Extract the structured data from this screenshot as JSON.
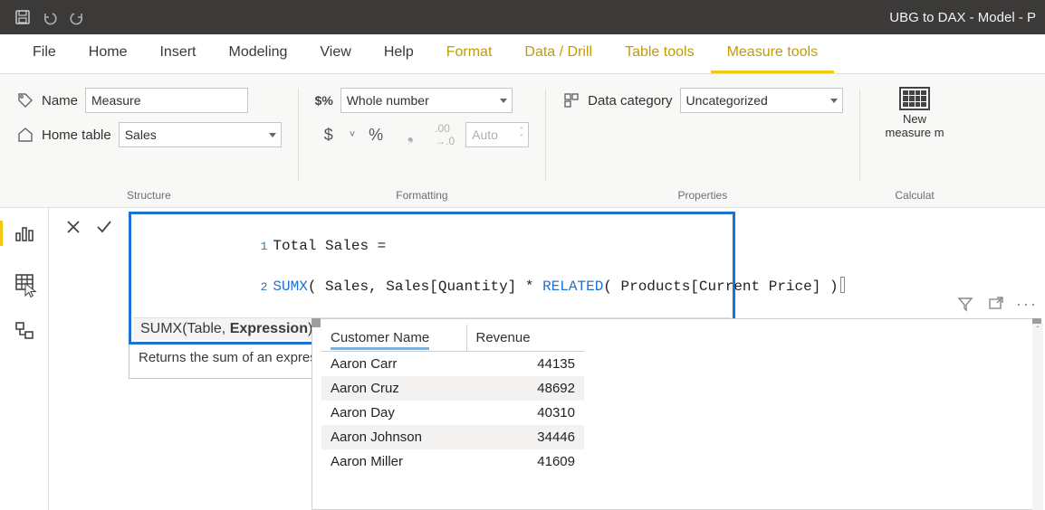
{
  "titlebar": {
    "title": "UBG to DAX - Model - P"
  },
  "tabs": {
    "items": [
      {
        "label": "File"
      },
      {
        "label": "Home"
      },
      {
        "label": "Insert"
      },
      {
        "label": "Modeling"
      },
      {
        "label": "View"
      },
      {
        "label": "Help"
      },
      {
        "label": "Format"
      },
      {
        "label": "Data / Drill"
      },
      {
        "label": "Table tools"
      },
      {
        "label": "Measure tools"
      }
    ]
  },
  "ribbon": {
    "structure": {
      "name_label": "Name",
      "name_value": "Measure",
      "home_table_label": "Home table",
      "home_table_value": "Sales",
      "group_label": "Structure"
    },
    "formatting": {
      "format_value": "Whole number",
      "currency": "$",
      "percent": "%",
      "comma": ",",
      "decimals_icon": ".00",
      "auto": "Auto",
      "group_label": "Formatting"
    },
    "properties": {
      "data_category_label": "Data category",
      "data_category_value": "Uncategorized",
      "group_label": "Properties"
    },
    "calculations": {
      "button_line1": "New",
      "button_line2": "measure m",
      "group_label": "Calculat"
    }
  },
  "formula": {
    "line1": "Total Sales = ",
    "sumx": "SUMX",
    "mid": "( Sales, Sales[Quantity] * ",
    "related": "RELATED",
    "tail": "( Products[Current Price] )",
    "signature_prefix": "SUMX(Table, ",
    "signature_bold": "Expression",
    "signature_suffix": ")",
    "description": "Returns the sum of an expression evaluated for each row in a table."
  },
  "table": {
    "headers": {
      "c1": "Customer Name",
      "c2": "Revenue"
    },
    "rows": [
      {
        "name": "Aaron Carr",
        "rev": "44135"
      },
      {
        "name": "Aaron Cruz",
        "rev": "48692"
      },
      {
        "name": "Aaron Day",
        "rev": "40310"
      },
      {
        "name": "Aaron Johnson",
        "rev": "34446"
      },
      {
        "name": "Aaron Miller",
        "rev": "41609"
      }
    ]
  }
}
